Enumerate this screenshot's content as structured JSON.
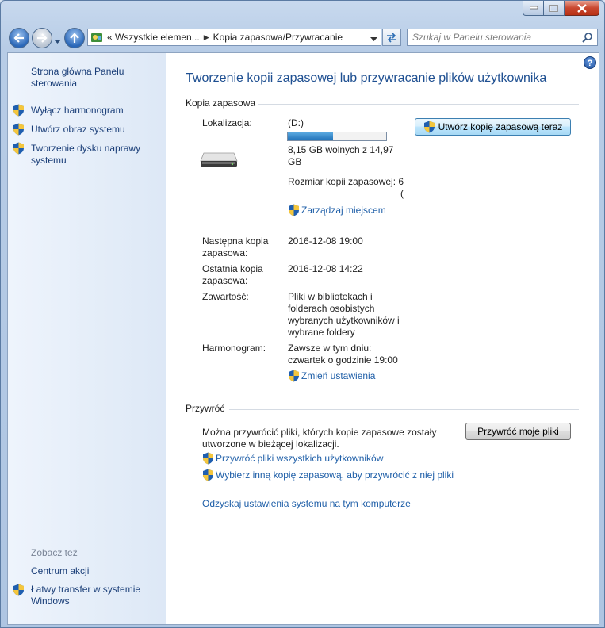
{
  "window": {
    "title": ""
  },
  "nav": {
    "address": {
      "segments": [
        "« Wszystkie elemen...",
        "Kopia zapasowa/Przywracanie"
      ]
    },
    "search_placeholder": "Szukaj w Panelu sterowania"
  },
  "sidebar": {
    "home": "Strona główna Panelu sterowania",
    "items": [
      {
        "label": "Wyłącz harmonogram"
      },
      {
        "label": "Utwórz obraz systemu"
      },
      {
        "label": "Tworzenie dysku naprawy systemu"
      }
    ],
    "see_also_title": "Zobacz też",
    "see_also": [
      {
        "label": "Centrum akcji"
      },
      {
        "label": "Łatwy transfer w systemie Windows"
      }
    ]
  },
  "main": {
    "title": "Tworzenie kopii zapasowej lub przywracanie plików użytkownika",
    "backup": {
      "section_label": "Kopia zapasowa",
      "location_label": "Lokalizacja:",
      "location_value": "(D:)",
      "space_free_fraction": 0.46,
      "space_text": "8,15 GB wolnych z 14,97 GB",
      "backup_size_label": "Rozmiar kopii zapasowej: 6",
      "backup_size_cut": "(",
      "manage_space": "Zarządzaj miejscem",
      "backup_now_button": "Utwórz kopię zapasową teraz",
      "next_label": "Następna kopia zapasowa:",
      "next_value": "2016-12-08 19:00",
      "last_label": "Ostatnia kopia zapasowa:",
      "last_value": "2016-12-08 14:22",
      "contents_label": "Zawartość:",
      "contents_value": "Pliki w bibliotekach i folderach osobistych wybranych użytkowników i wybrane foldery",
      "schedule_label": "Harmonogram:",
      "schedule_value": "Zawsze w tym dniu: czwartek o godzinie 19:00",
      "change_settings": "Zmień ustawienia"
    },
    "restore": {
      "section_label": "Przywróć",
      "description": "Można przywrócić pliki, których kopie zapasowe zostały utworzone w bieżącej lokalizacji.",
      "restore_my_files_button": "Przywróć moje pliki",
      "restore_all_users": "Przywróć pliki wszystkich użytkowników",
      "select_other_backup": "Wybierz inną kopię zapasową, aby przywrócić z niej pliki",
      "recover_system": "Odzyskaj ustawienia systemu na tym komputerze"
    }
  },
  "colors": {
    "title_blue": "#1e4f91",
    "link_blue": "#1f5fa8",
    "progress_fill": "#1f71b8"
  }
}
